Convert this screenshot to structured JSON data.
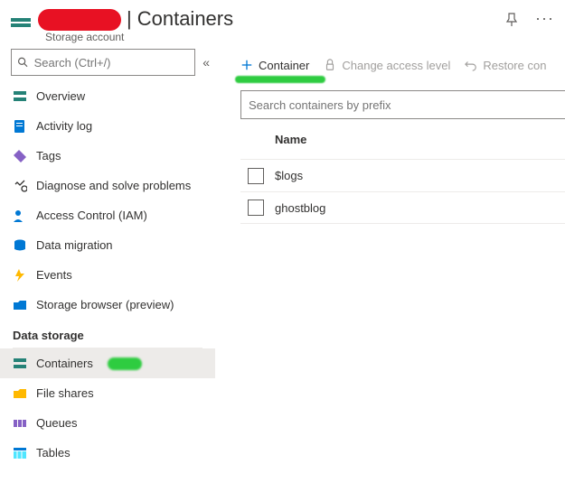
{
  "header": {
    "title_separator": "|",
    "title": "Containers",
    "subtitle": "Storage account"
  },
  "sidebar": {
    "search_placeholder": "Search (Ctrl+/)",
    "items": {
      "overview": "Overview",
      "activity_log": "Activity log",
      "tags": "Tags",
      "diagnose": "Diagnose and solve problems",
      "iam": "Access Control (IAM)",
      "data_migration": "Data migration",
      "events": "Events",
      "storage_browser": "Storage browser (preview)"
    },
    "section_data_storage": "Data storage",
    "data_storage_items": {
      "containers": "Containers",
      "file_shares": "File shares",
      "queues": "Queues",
      "tables": "Tables"
    }
  },
  "toolbar": {
    "add_container": "Container",
    "change_access": "Change access level",
    "restore": "Restore con"
  },
  "filter": {
    "placeholder": "Search containers by prefix"
  },
  "table": {
    "column_name": "Name",
    "rows": [
      {
        "name": "$logs"
      },
      {
        "name": "ghostblog"
      }
    ]
  }
}
